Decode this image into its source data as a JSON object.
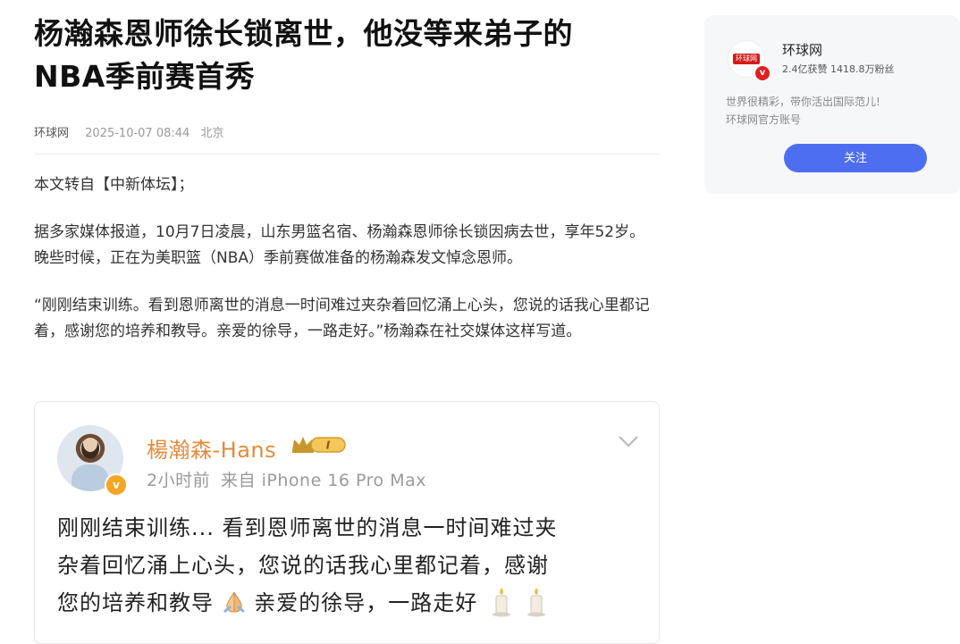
{
  "article": {
    "title_line1": "杨瀚森恩师徐长锁离世，他没等来弟子的",
    "title_line2": "NBA季前赛首秀",
    "source": "环球网",
    "datetime": "2025-10-07 08:44",
    "location": "北京",
    "paragraphs": [
      "本文转自【中新体坛】；",
      "据多家媒体报道，10月7日凌晨，山东男篮名宿、杨瀚森恩师徐长锁因病去世，享年52岁。晚些时候，正在为美职篮（NBA）季前赛做准备的杨瀚森发文悼念恩师。",
      "“刚刚结束训练。看到恩师离世的消息一时间难过夹杂着回忆涌上心头，您说的话我心里都记着，感谢您的培养和教导。亲爱的徐导，一路走好。”杨瀚森在社交媒体这样写道。"
    ]
  },
  "embed": {
    "username": "楊瀚森-Hans",
    "verify_badge": "v",
    "crown_level": "I",
    "time": "2小时前",
    "device": "来自 iPhone 16 Pro Max",
    "post_line1": "刚刚结束训练... 看到恩师离世的消息一时间难过夹",
    "post_line2": "杂着回忆涌上心头，您说的话我心里都记着，感谢",
    "post_line3a": "您的培养和教导",
    "post_line3b": " 亲爱的徐导，一路走好",
    "icons": [
      "avatar",
      "crown-icon",
      "chevron-down-icon",
      "praying-hands-icon",
      "candle-icon"
    ]
  },
  "sidebar": {
    "name": "环球网",
    "logo_text": "环球网",
    "verify_badge": "v",
    "stats": "2.4亿获赞 1418.8万粉丝",
    "desc_line1": "世界很精彩，带你活出国际范儿!",
    "desc_line2": "环球网官方账号",
    "follow_label": "关注",
    "accent_color": "#4e6ef2"
  }
}
